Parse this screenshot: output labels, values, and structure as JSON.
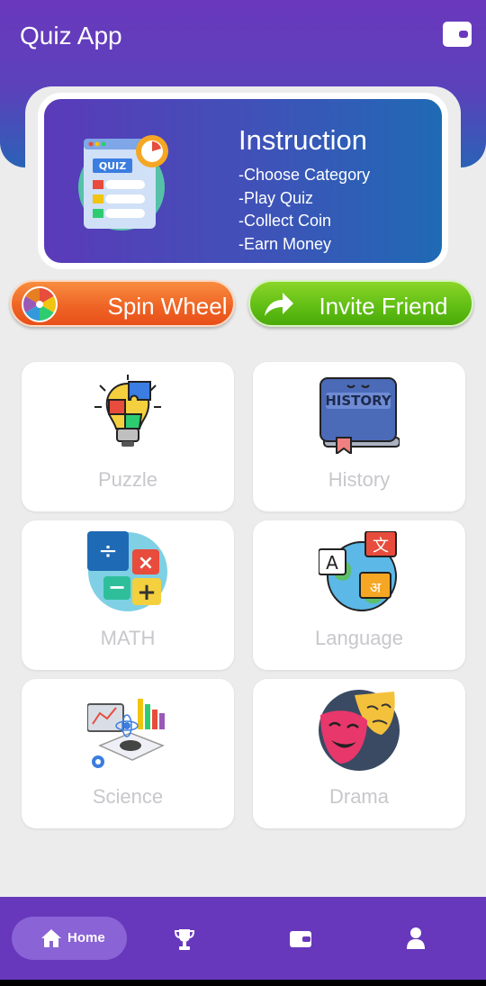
{
  "app": {
    "title": "Quiz App"
  },
  "header_icons": {
    "wallet": "wallet-icon"
  },
  "instruction": {
    "title": "Instruction",
    "lines": [
      "-Choose Category",
      "-Play Quiz",
      "-Collect Coin",
      "-Earn Money"
    ],
    "illustration": "quiz-clipboard-icon"
  },
  "actions": {
    "spin": {
      "label": "Spin Wheel",
      "icon": "spin-wheel-icon"
    },
    "invite": {
      "label": "Invite Friend",
      "icon": "share-arrow-icon"
    }
  },
  "categories": [
    {
      "label": "Puzzle",
      "icon": "puzzle-bulb-icon"
    },
    {
      "label": "History",
      "icon": "history-book-icon"
    },
    {
      "label": "MATH",
      "icon": "math-operators-icon"
    },
    {
      "label": "Language",
      "icon": "language-globe-icon"
    },
    {
      "label": "Science",
      "icon": "science-lab-icon"
    },
    {
      "label": "Drama",
      "icon": "drama-masks-icon"
    }
  ],
  "nav": {
    "items": [
      {
        "label": "Home",
        "icon": "home-icon",
        "active": true
      },
      {
        "label": "",
        "icon": "trophy-icon"
      },
      {
        "label": "",
        "icon": "wallet-icon"
      },
      {
        "label": "",
        "icon": "user-icon"
      }
    ]
  },
  "colors": {
    "primary": "#6738bb",
    "spin": "#ee6224",
    "invite": "#5fbd14",
    "background": "#ececec",
    "category_label": "#c7c7cc"
  }
}
